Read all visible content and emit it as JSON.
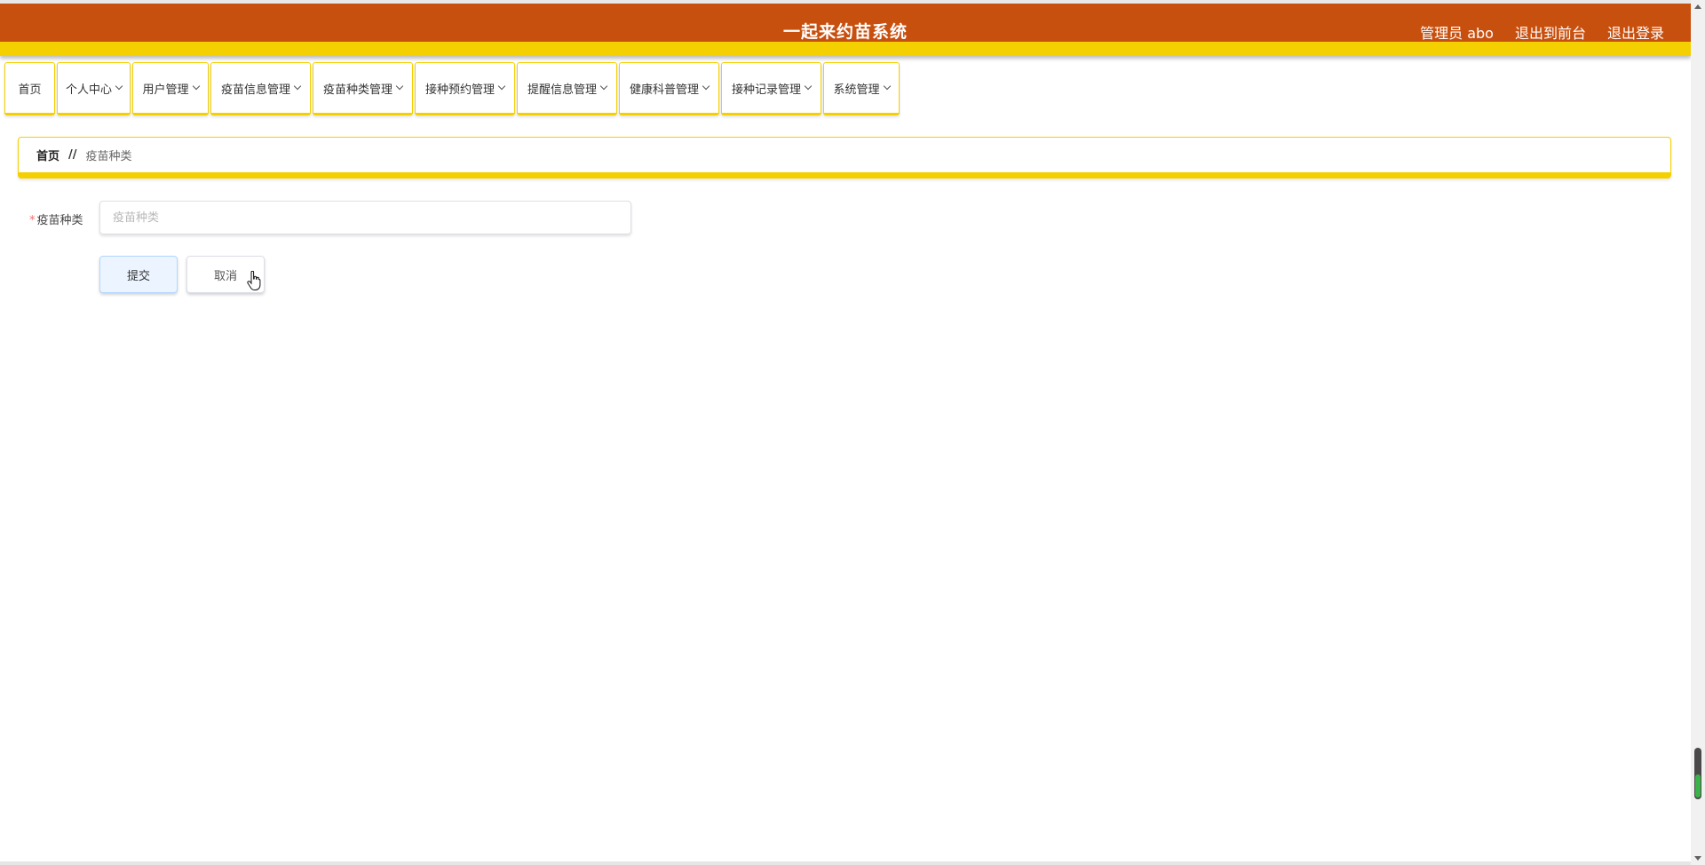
{
  "header": {
    "title": "一起来约苗系统",
    "user_label": "管理员 abo",
    "front_link": "退出到前台",
    "logout_link": "退出登录",
    "colors": {
      "header": "#c8500f",
      "accent": "#f5d000"
    }
  },
  "nav": {
    "items": [
      {
        "label": "首页",
        "dropdown": false
      },
      {
        "label": "个人中心",
        "dropdown": true
      },
      {
        "label": "用户管理",
        "dropdown": true
      },
      {
        "label": "疫苗信息管理",
        "dropdown": true
      },
      {
        "label": "疫苗种类管理",
        "dropdown": true
      },
      {
        "label": "接种预约管理",
        "dropdown": true
      },
      {
        "label": "提醒信息管理",
        "dropdown": true
      },
      {
        "label": "健康科普管理",
        "dropdown": true
      },
      {
        "label": "接种记录管理",
        "dropdown": true
      },
      {
        "label": "系统管理",
        "dropdown": true
      }
    ]
  },
  "breadcrumb": {
    "home": "首页",
    "separator": "//",
    "current": "疫苗种类"
  },
  "form": {
    "field_label": "疫苗种类",
    "required_mark": "*",
    "field_placeholder": "疫苗种类",
    "field_value": "",
    "submit_label": "提交",
    "cancel_label": "取消"
  }
}
